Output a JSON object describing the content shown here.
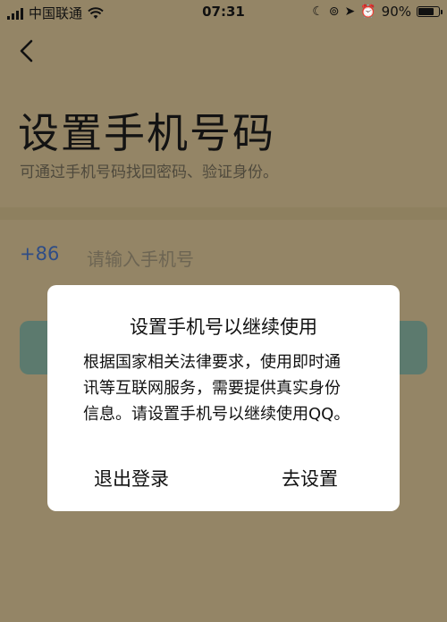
{
  "status_bar": {
    "carrier": "中国联通",
    "time": "07:31",
    "battery": "90%",
    "battery_level": 0.9
  },
  "page": {
    "title": "设置手机号码",
    "subtitle": "可通过手机号码找回密码、验证身份。",
    "country_code": "+86",
    "phone_placeholder": "请输入手机号"
  },
  "dialog": {
    "title": "设置手机号以继续使用",
    "body_lines": [
      "根据国家相关法律要求，使用即时通",
      "讯等互联网服务，需要提供真实身份",
      "信息。请设置手机号以继续使用QQ。"
    ],
    "cancel_label": "退出登录",
    "confirm_label": "去设置"
  },
  "colors": {
    "background": "#948566",
    "accent_blue": "#2f4d86",
    "button_green": "#5c7a6e",
    "dialog_bg": "#ffffff"
  }
}
